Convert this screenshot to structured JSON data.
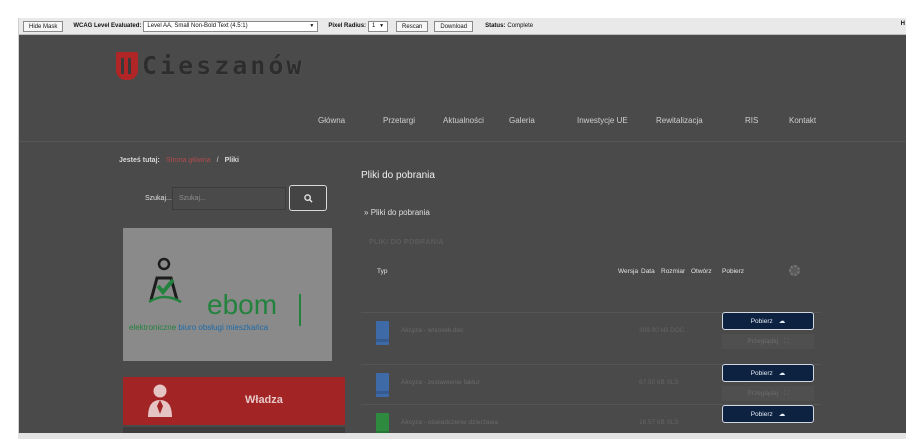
{
  "toolbar": {
    "hide_mask": "Hide Mask",
    "level_label": "WCAG Level Evaluated:",
    "level_value": "Level AA, Small Non-Bold Text (4.5:1)",
    "radius_label": "Pixel Radius:",
    "radius_value": "1",
    "rescan": "Rescan",
    "download": "Download",
    "status_label": "Status:",
    "status_value": "Complete",
    "edge_glyph": "H"
  },
  "header": {
    "logo_text": "Cieszanów",
    "nav": [
      "Główna",
      "Przetargi",
      "Aktualności",
      "Galeria",
      "Inwestycje UE",
      "Rewitalizacja",
      "RIS",
      "Kontakt"
    ]
  },
  "breadcrumb": {
    "prefix": "Jesteś tutaj:",
    "home": "Strona główna",
    "separator": "/",
    "current": "Pliki"
  },
  "search": {
    "label": "Szukaj...",
    "placeholder": "Szukaj..."
  },
  "sidebar": {
    "ebom_word": "ebom",
    "ebom_tagline_green": "elektroniczne",
    "ebom_tagline_blue": "biuro obsługi mieszkańca",
    "wladza_label": "Władza"
  },
  "main": {
    "title": "Pliki do pobrania",
    "toggle": "Pliki do pobrania",
    "section_heading": "PLIKI DO POBRANIA",
    "columns": {
      "type": "Typ",
      "version": "Wersja",
      "date": "Data",
      "size": "Rozmiar",
      "hits": "Otwórz",
      "download": "Pobierz"
    },
    "files": [
      {
        "name": "Akcyza - wniosek.doc",
        "meta": "309.90 kB   DOC",
        "color": "#3f6aa8",
        "download": "Pobierz",
        "preview": "Przeglądaj"
      },
      {
        "name": "Akcyza - zestawienie faktur",
        "meta": "67.50 kB   XLS",
        "color": "#3f6aa8",
        "download": "Pobierz",
        "preview": "Przeglądaj"
      },
      {
        "name": "Akcyza - oświadczenie dzierżawa",
        "meta": "16.57 kB   XLS",
        "color": "#2e8a3e",
        "download": "Pobierz",
        "preview": ""
      }
    ]
  },
  "colors": {
    "page_bg": "#4a4a4a",
    "brand_red": "#a22424",
    "download_btn": "#0d2240",
    "ebom_green": "#23823e",
    "ebom_blue": "#1e6aa8"
  }
}
